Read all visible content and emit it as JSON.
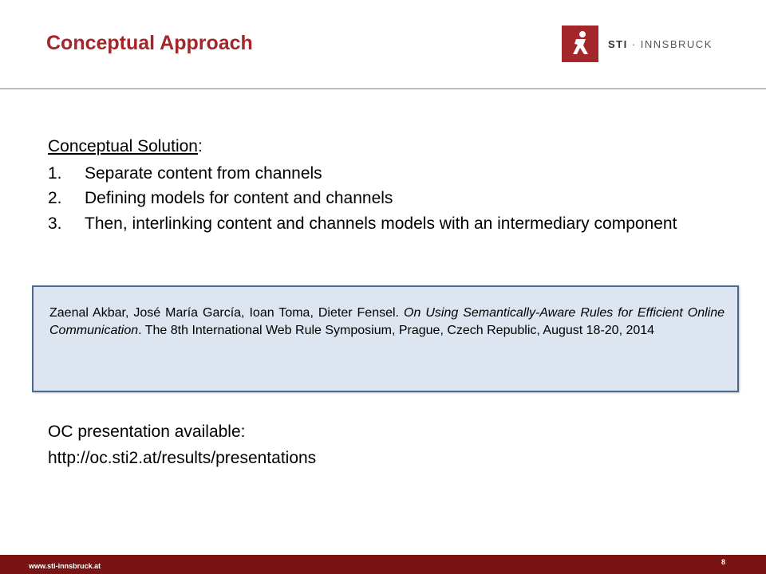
{
  "slide": {
    "title": "Conceptual Approach",
    "logo": {
      "brand": "STI",
      "separator": " · ",
      "suffix": "INNSBRUCK"
    },
    "section_heading": "Conceptual Solution",
    "section_heading_suffix": ":",
    "steps": [
      {
        "num": "1.",
        "text": "Separate content from channels"
      },
      {
        "num": "2.",
        "text": "Defining models for content and channels"
      },
      {
        "num": "3.",
        "text": "Then, interlinking content and channels models with an intermediary component"
      }
    ],
    "reference": {
      "authors": "Zaenal Akbar, José María García, Ioan Toma, Dieter Fensel.",
      "paper_title": "On Using Semantically-Aware Rules for Efficient Online Communication",
      "venue": ". The 8th International Web Rule Symposium, Prague, Czech Republic, August 18-20, 2014"
    },
    "oc_label": "OC presentation available:",
    "oc_url": "http://oc.sti2.at/results/presentations",
    "footer_url": "www.sti-innsbruck.at",
    "page_number": "8"
  },
  "colors": {
    "title": "#a3262a",
    "footer": "#7a1414",
    "box_fill": "#dde5f0",
    "box_border": "#4a6a94"
  }
}
